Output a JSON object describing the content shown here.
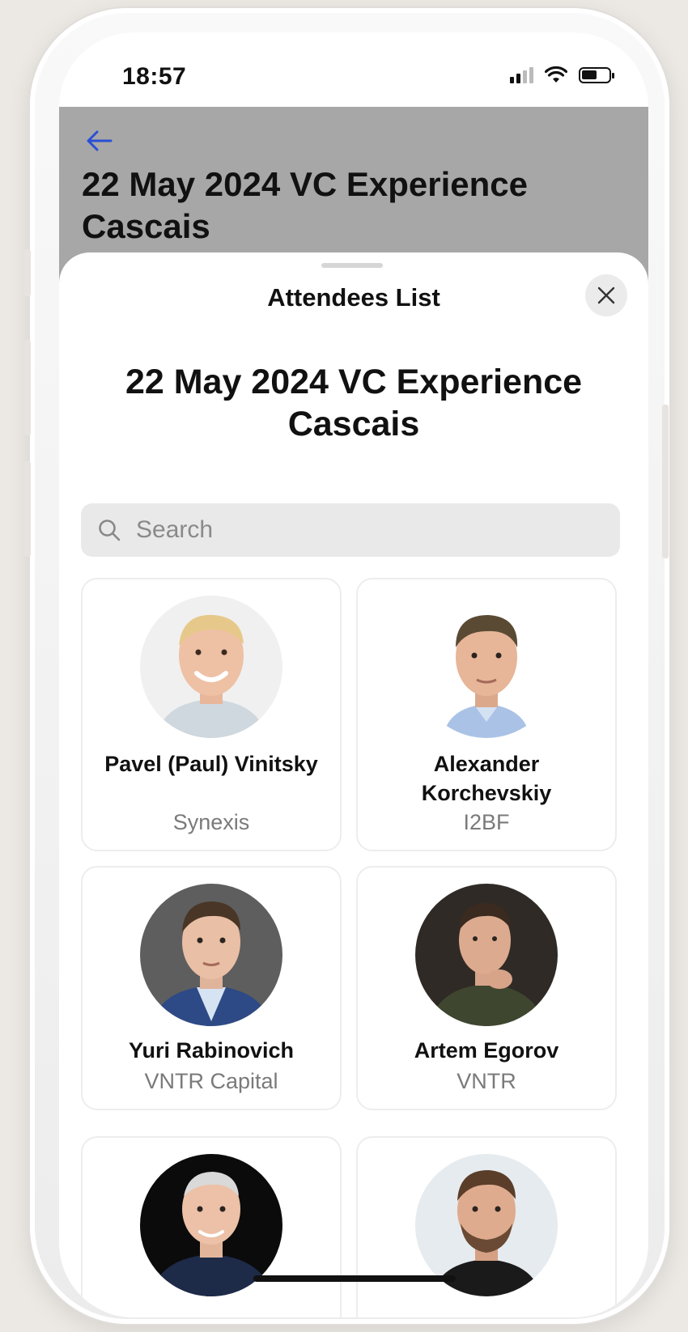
{
  "status_bar": {
    "time": "18:57"
  },
  "header": {
    "title": "22 May 2024 VC Experience Cascais"
  },
  "sheet": {
    "title": "Attendees List",
    "event_title_line1": "22 May 2024 VC Experience",
    "event_title_line2": "Cascais",
    "search": {
      "placeholder": "Search",
      "value": ""
    }
  },
  "attendees": [
    {
      "name": "Pavel (Paul) Vinitsky",
      "company": "Synexis"
    },
    {
      "name": "Alexander Korchevskiy",
      "company": "I2BF"
    },
    {
      "name": "Yuri Rabinovich",
      "company": "VNTR Capital"
    },
    {
      "name": "Artem Egorov",
      "company": "VNTR"
    },
    {
      "name": "",
      "company": ""
    },
    {
      "name": "",
      "company": ""
    }
  ],
  "colors": {
    "accent": "#2a4fd6",
    "overlay": "#a7a7a7",
    "card_border": "#ededed",
    "muted_text": "#7a7a7a"
  }
}
